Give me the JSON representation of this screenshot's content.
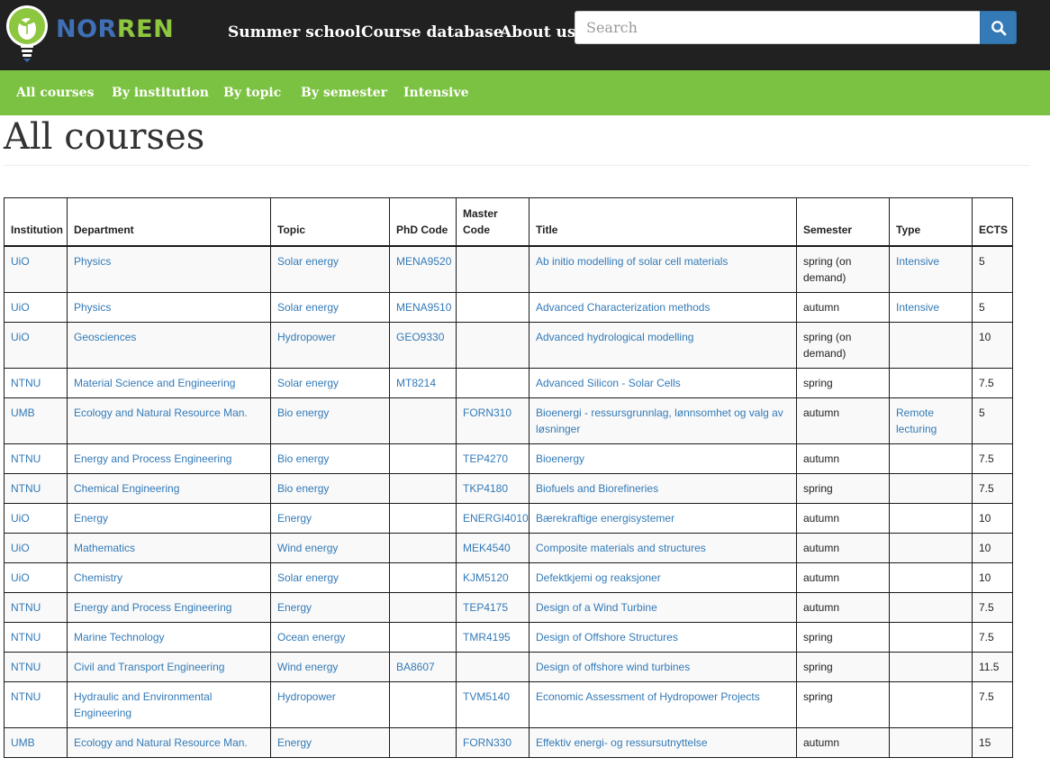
{
  "brand": {
    "part1": "NOR",
    "part2": "REN"
  },
  "topnav": [
    "Summer school",
    "Course database",
    "About us"
  ],
  "search": {
    "placeholder": "Search",
    "value": ""
  },
  "subnav": [
    "All courses",
    "By institution",
    "By topic",
    "By semester",
    "Intensive"
  ],
  "page_title": "All courses",
  "table": {
    "headers": [
      "Institution",
      "Department",
      "Topic",
      "PhD Code",
      "Master Code",
      "Title",
      "Semester",
      "Type",
      "ECTS"
    ],
    "rows": [
      [
        "UiO",
        "Physics",
        "Solar energy",
        "MENA9520",
        "",
        "Ab initio modelling of solar cell materials",
        "spring (on demand)",
        "Intensive",
        "5"
      ],
      [
        "UiO",
        "Physics",
        "Solar energy",
        "MENA9510",
        "",
        "Advanced Characterization methods",
        "autumn",
        "Intensive",
        "5"
      ],
      [
        "UiO",
        "Geosciences",
        "Hydropower",
        "GEO9330",
        "",
        "Advanced hydrological modelling",
        "spring (on demand)",
        "",
        "10"
      ],
      [
        "NTNU",
        "Material Science and Engineering",
        "Solar energy",
        "MT8214",
        "",
        "Advanced Silicon - Solar Cells",
        "spring",
        "",
        "7.5"
      ],
      [
        "UMB",
        "Ecology and Natural Resource Man.",
        "Bio energy",
        "",
        "FORN310",
        "Bioenergi - ressursgrunnlag, lønnsomhet og valg av løsninger",
        "autumn",
        "Remote lecturing",
        "5"
      ],
      [
        "NTNU",
        "Energy and Process Engineering",
        "Bio energy",
        "",
        "TEP4270",
        "Bioenergy",
        "autumn",
        "",
        "7.5"
      ],
      [
        "NTNU",
        "Chemical Engineering",
        "Bio energy",
        "",
        "TKP4180",
        "Biofuels and Biorefineries",
        "spring",
        "",
        "7.5"
      ],
      [
        "UiO",
        "Energy",
        "Energy",
        "",
        "ENERGI4010",
        "Bærekraftige energisystemer",
        "autumn",
        "",
        "10"
      ],
      [
        "UiO",
        "Mathematics",
        "Wind energy",
        "",
        "MEK4540",
        "Composite materials and structures",
        "autumn",
        "",
        "10"
      ],
      [
        "UiO",
        "Chemistry",
        "Solar energy",
        "",
        "KJM5120",
        "Defektkjemi og reaksjoner",
        "autumn",
        "",
        "10"
      ],
      [
        "NTNU",
        "Energy and Process Engineering",
        "Energy",
        "",
        "TEP4175",
        "Design of a Wind Turbine",
        "autumn",
        "",
        "7.5"
      ],
      [
        "NTNU",
        "Marine Technology",
        "Ocean energy",
        "",
        "TMR4195",
        "Design of Offshore Structures",
        "spring",
        "",
        "7.5"
      ],
      [
        "NTNU",
        "Civil and Transport Engineering",
        "Wind energy",
        "BA8607",
        "",
        "Design of offshore wind turbines",
        "spring",
        "",
        "11.5"
      ],
      [
        "NTNU",
        "Hydraulic and Environmental Engineering",
        "Hydropower",
        "",
        "TVM5140",
        "Economic Assessment of Hydropower Projects",
        "spring",
        "",
        "7.5"
      ],
      [
        "UMB",
        "Ecology and Natural Resource Man.",
        "Energy",
        "",
        "FORN330",
        "Effektiv energi- og ressursutnyttelse",
        "autumn",
        "",
        "15"
      ]
    ]
  },
  "colors": {
    "topbar": "#212121",
    "subnav": "#7cc242",
    "link": "#337ab7",
    "search_button": "#337ab7"
  }
}
